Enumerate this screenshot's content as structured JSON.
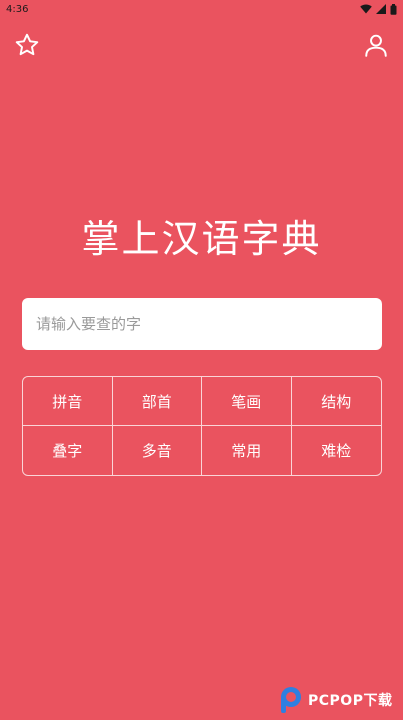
{
  "status_bar": {
    "time": "4:36"
  },
  "header": {
    "star_icon": "star-icon",
    "user_icon": "user-icon"
  },
  "app": {
    "title": "掌上汉语字典"
  },
  "search": {
    "placeholder": "请输入要查的字"
  },
  "categories": [
    {
      "label": "拼音"
    },
    {
      "label": "部首"
    },
    {
      "label": "笔画"
    },
    {
      "label": "结构"
    },
    {
      "label": "叠字"
    },
    {
      "label": "多音"
    },
    {
      "label": "常用"
    },
    {
      "label": "难检"
    }
  ],
  "watermark": {
    "text": "PCPOP下载"
  },
  "colors": {
    "background": "#ea535f",
    "foreground": "#ffffff"
  }
}
